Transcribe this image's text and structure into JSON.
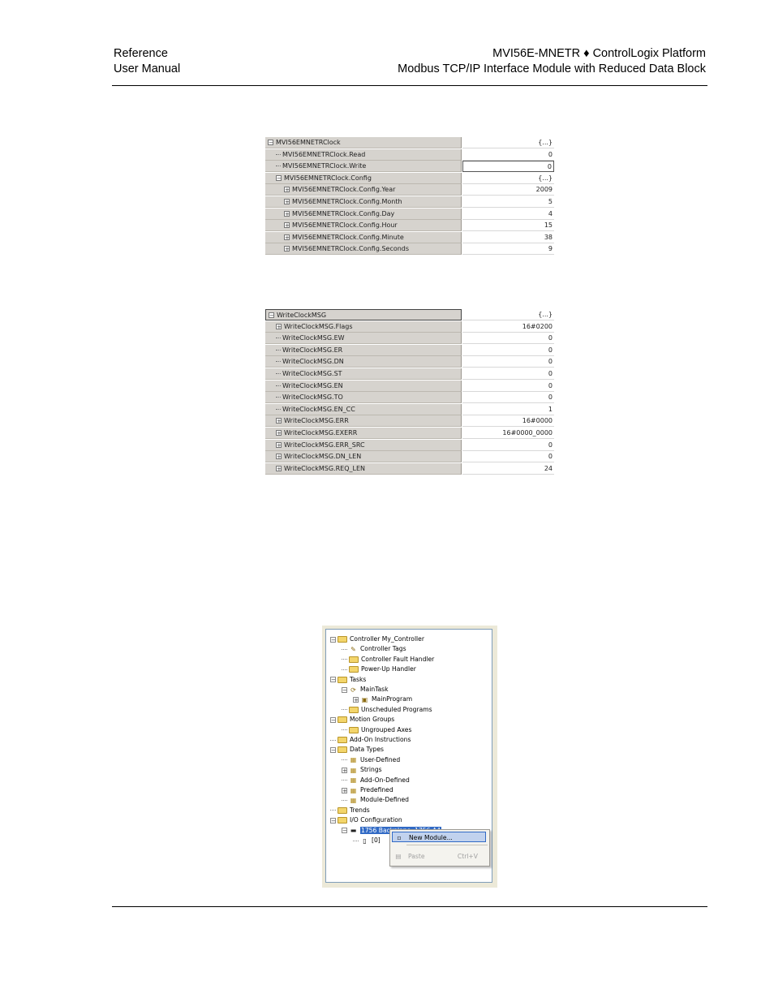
{
  "header": {
    "left_line1": "Reference",
    "left_line2": "User Manual",
    "right_line1": "MVI56E-MNETR ♦ ControlLogix Platform",
    "right_line2": "Modbus TCP/IP Interface Module with Reduced Data Block"
  },
  "clock_grid": {
    "rows": [
      {
        "indent": 0,
        "expander": "−",
        "name": "MVI56EMNETRClock",
        "value": "{...}"
      },
      {
        "indent": 1,
        "expander": "",
        "name": "MVI56EMNETRClock.Read",
        "value": "0"
      },
      {
        "indent": 1,
        "expander": "",
        "name": "MVI56EMNETRClock.Write",
        "value": "0"
      },
      {
        "indent": 1,
        "expander": "−",
        "name": "MVI56EMNETRClock.Config",
        "value": "{...}"
      },
      {
        "indent": 2,
        "expander": "+",
        "name": "MVI56EMNETRClock.Config.Year",
        "value": "2009"
      },
      {
        "indent": 2,
        "expander": "+",
        "name": "MVI56EMNETRClock.Config.Month",
        "value": "5"
      },
      {
        "indent": 2,
        "expander": "+",
        "name": "MVI56EMNETRClock.Config.Day",
        "value": "4"
      },
      {
        "indent": 2,
        "expander": "+",
        "name": "MVI56EMNETRClock.Config.Hour",
        "value": "15"
      },
      {
        "indent": 2,
        "expander": "+",
        "name": "MVI56EMNETRClock.Config.Minute",
        "value": "38"
      },
      {
        "indent": 2,
        "expander": "+",
        "name": "MVI56EMNETRClock.Config.Seconds",
        "value": "9"
      }
    ]
  },
  "msg_grid": {
    "rows": [
      {
        "indent": 0,
        "expander": "−",
        "name": "WriteClockMSG",
        "value": "{...}"
      },
      {
        "indent": 1,
        "expander": "+",
        "name": "WriteClockMSG.Flags",
        "value": "16#0200"
      },
      {
        "indent": 1,
        "expander": "",
        "name": "WriteClockMSG.EW",
        "value": "0"
      },
      {
        "indent": 1,
        "expander": "",
        "name": "WriteClockMSG.ER",
        "value": "0"
      },
      {
        "indent": 1,
        "expander": "",
        "name": "WriteClockMSG.DN",
        "value": "0"
      },
      {
        "indent": 1,
        "expander": "",
        "name": "WriteClockMSG.ST",
        "value": "0"
      },
      {
        "indent": 1,
        "expander": "",
        "name": "WriteClockMSG.EN",
        "value": "0"
      },
      {
        "indent": 1,
        "expander": "",
        "name": "WriteClockMSG.TO",
        "value": "0"
      },
      {
        "indent": 1,
        "expander": "",
        "name": "WriteClockMSG.EN_CC",
        "value": "1"
      },
      {
        "indent": 1,
        "expander": "+",
        "name": "WriteClockMSG.ERR",
        "value": "16#0000"
      },
      {
        "indent": 1,
        "expander": "+",
        "name": "WriteClockMSG.EXERR",
        "value": "16#0000_0000"
      },
      {
        "indent": 1,
        "expander": "+",
        "name": "WriteClockMSG.ERR_SRC",
        "value": "0"
      },
      {
        "indent": 1,
        "expander": "+",
        "name": "WriteClockMSG.DN_LEN",
        "value": "0"
      },
      {
        "indent": 1,
        "expander": "+",
        "name": "WriteClockMSG.REQ_LEN",
        "value": "24"
      }
    ]
  },
  "organizer": {
    "items": [
      {
        "level": 0,
        "expander": "−",
        "icon": "folder-icon",
        "label": "Controller My_Controller"
      },
      {
        "level": 1,
        "expander": "",
        "icon": "tags-icon",
        "label": "Controller Tags"
      },
      {
        "level": 1,
        "expander": "",
        "icon": "folder-icon",
        "label": "Controller Fault Handler"
      },
      {
        "level": 1,
        "expander": "",
        "icon": "folder-icon",
        "label": "Power-Up Handler"
      },
      {
        "level": 0,
        "expander": "−",
        "icon": "folder-icon",
        "label": "Tasks"
      },
      {
        "level": 1,
        "expander": "−",
        "icon": "task-icon",
        "label": "MainTask"
      },
      {
        "level": 2,
        "expander": "+",
        "icon": "program-icon",
        "label": "MainProgram"
      },
      {
        "level": 1,
        "expander": "",
        "icon": "folder-icon",
        "label": "Unscheduled Programs"
      },
      {
        "level": 0,
        "expander": "−",
        "icon": "folder-icon",
        "label": "Motion Groups"
      },
      {
        "level": 1,
        "expander": "",
        "icon": "folder-icon",
        "label": "Ungrouped Axes"
      },
      {
        "level": 0,
        "expander": "",
        "icon": "folder-icon",
        "label": "Add-On Instructions"
      },
      {
        "level": 0,
        "expander": "−",
        "icon": "folder-icon",
        "label": "Data Types"
      },
      {
        "level": 1,
        "expander": "",
        "icon": "datatype-icon",
        "label": "User-Defined"
      },
      {
        "level": 1,
        "expander": "+",
        "icon": "datatype-icon",
        "label": "Strings"
      },
      {
        "level": 1,
        "expander": "",
        "icon": "datatype-icon",
        "label": "Add-On-Defined"
      },
      {
        "level": 1,
        "expander": "+",
        "icon": "datatype-icon",
        "label": "Predefined"
      },
      {
        "level": 1,
        "expander": "",
        "icon": "datatype-icon",
        "label": "Module-Defined"
      },
      {
        "level": 0,
        "expander": "",
        "icon": "folder-icon",
        "label": "Trends"
      },
      {
        "level": 0,
        "expander": "−",
        "icon": "folder-icon",
        "label": "I/O Configuration"
      },
      {
        "level": 1,
        "expander": "−",
        "icon": "backplane-icon",
        "label": "1756 Backplane, 1756-A4",
        "selected": true
      },
      {
        "level": 2,
        "expander": "",
        "icon": "module-icon",
        "label": "[0]"
      }
    ],
    "context_menu": {
      "new_module": "New Module...",
      "paste": "Paste",
      "paste_shortcut": "Ctrl+V"
    }
  }
}
